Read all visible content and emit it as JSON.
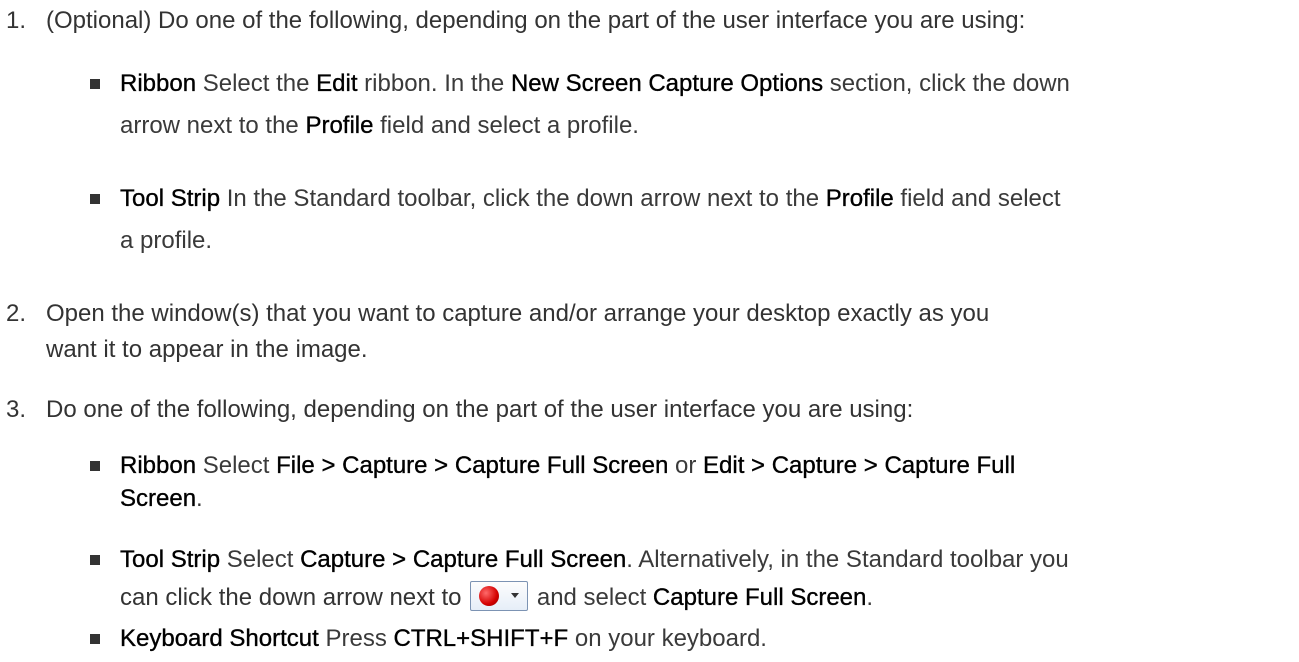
{
  "steps": [
    {
      "number": "1.",
      "text": "(Optional) Do one of the following, depending on the part of the user interface you are using:",
      "bullets": [
        {
          "line1": [
            {
              "t": "Ribbon",
              "b": true
            },
            {
              "t": " Select the ",
              "b": false
            },
            {
              "t": "Edit",
              "b": true
            },
            {
              "t": " ribbon. In the ",
              "b": false
            },
            {
              "t": "New Screen Capture Options",
              "b": true
            },
            {
              "t": " section, click the down",
              "b": false
            }
          ],
          "line2": [
            {
              "t": "arrow next to the ",
              "b": false
            },
            {
              "t": "Profile",
              "b": true
            },
            {
              "t": " field and select a profile.",
              "b": false
            }
          ]
        },
        {
          "line1": [
            {
              "t": "Tool Strip",
              "b": true
            },
            {
              "t": " In the Standard toolbar, click the down arrow next to the ",
              "b": false
            },
            {
              "t": "Profile",
              "b": true
            },
            {
              "t": " field and select",
              "b": false
            }
          ],
          "line2": [
            {
              "t": "a profile.",
              "b": false
            }
          ]
        }
      ]
    },
    {
      "number": "2.",
      "line1": "Open the window(s) that you want to capture and/or arrange your desktop exactly as you",
      "line2": "want it to appear in the image."
    },
    {
      "number": "3.",
      "text": "Do one of the following, depending on the part of the user interface you are using:",
      "bullets": [
        {
          "line1": [
            {
              "t": "Ribbon",
              "b": true
            },
            {
              "t": " Select ",
              "b": false
            },
            {
              "t": "File > Capture > Capture Full Screen",
              "b": true
            },
            {
              "t": " or ",
              "b": false
            },
            {
              "t": "Edit > Capture > Capture Full",
              "b": true
            }
          ],
          "line2": [
            {
              "t": "Screen",
              "b": true
            },
            {
              "t": ".",
              "b": false
            }
          ]
        },
        {
          "line1": [
            {
              "t": "Tool Strip",
              "b": true
            },
            {
              "t": " Select ",
              "b": false
            },
            {
              "t": "Capture > Capture Full Screen",
              "b": true
            },
            {
              "t": ". Alternatively, in the Standard toolbar you",
              "b": false
            }
          ],
          "line2_before": "can click the down arrow next to ",
          "line2_after": [
            {
              "t": " and select ",
              "b": false
            },
            {
              "t": "Capture Full Screen",
              "b": true
            },
            {
              "t": ".",
              "b": false
            }
          ],
          "icon": "record-dropdown-icon"
        },
        {
          "line1": [
            {
              "t": "Keyboard Shortcut",
              "b": true
            },
            {
              "t": " Press ",
              "b": false
            },
            {
              "t": "CTRL+SHIFT+F",
              "b": true
            },
            {
              "t": " on your keyboard.",
              "b": false
            }
          ]
        }
      ]
    }
  ]
}
